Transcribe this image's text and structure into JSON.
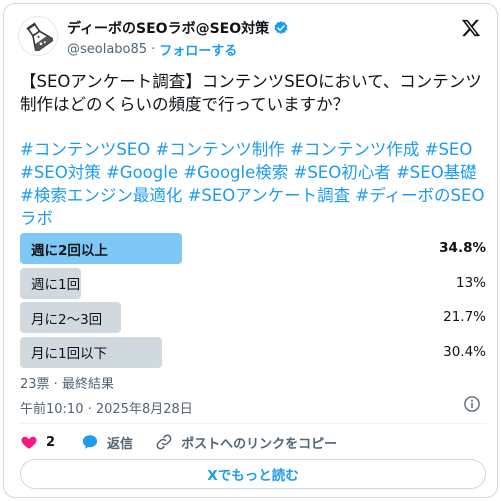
{
  "author": {
    "name": "ディーボのSEOラボ@SEO対策",
    "handle": "@seolabo85",
    "separator": "·",
    "follow_label": "フォローする"
  },
  "tweet": {
    "text": "【SEOアンケート調査】コンテンツSEOにおいて、コンテンツ制作はどのくらいの頻度で行っていますか？",
    "hashtags": [
      "#コンテンツSEO",
      "#コンテンツ制作",
      "#コンテンツ作成",
      "#SEO",
      "#SEO対策",
      "#Google",
      "#Google検索",
      "#SEO初心者",
      "#SEO基礎",
      "#検索エンジン最適化",
      "#SEOアンケート調査",
      "#ディーボのSEOラボ"
    ]
  },
  "poll": {
    "options": [
      {
        "label": "週に2回以上",
        "percent": "34.8%",
        "value": 34.8,
        "winner": true
      },
      {
        "label": "週に1回",
        "percent": "13%",
        "value": 13,
        "winner": false
      },
      {
        "label": "月に2〜3回",
        "percent": "21.7%",
        "value": 21.7,
        "winner": false
      },
      {
        "label": "月に1回以下",
        "percent": "30.4%",
        "value": 30.4,
        "winner": false
      }
    ],
    "meta": "23票 · 最終結果"
  },
  "timestamp": "午前10:10 · 2025年8月28日",
  "actions": {
    "like_count": "2",
    "reply_label": "返信",
    "copy_link_label": "ポストへのリンクをコピー"
  },
  "read_more_label": "Xでもっと読む",
  "colors": {
    "accent": "#1d9bf0",
    "winner_bar": "#7ec7f6",
    "bar": "#cfd9de",
    "like": "#f91880"
  }
}
